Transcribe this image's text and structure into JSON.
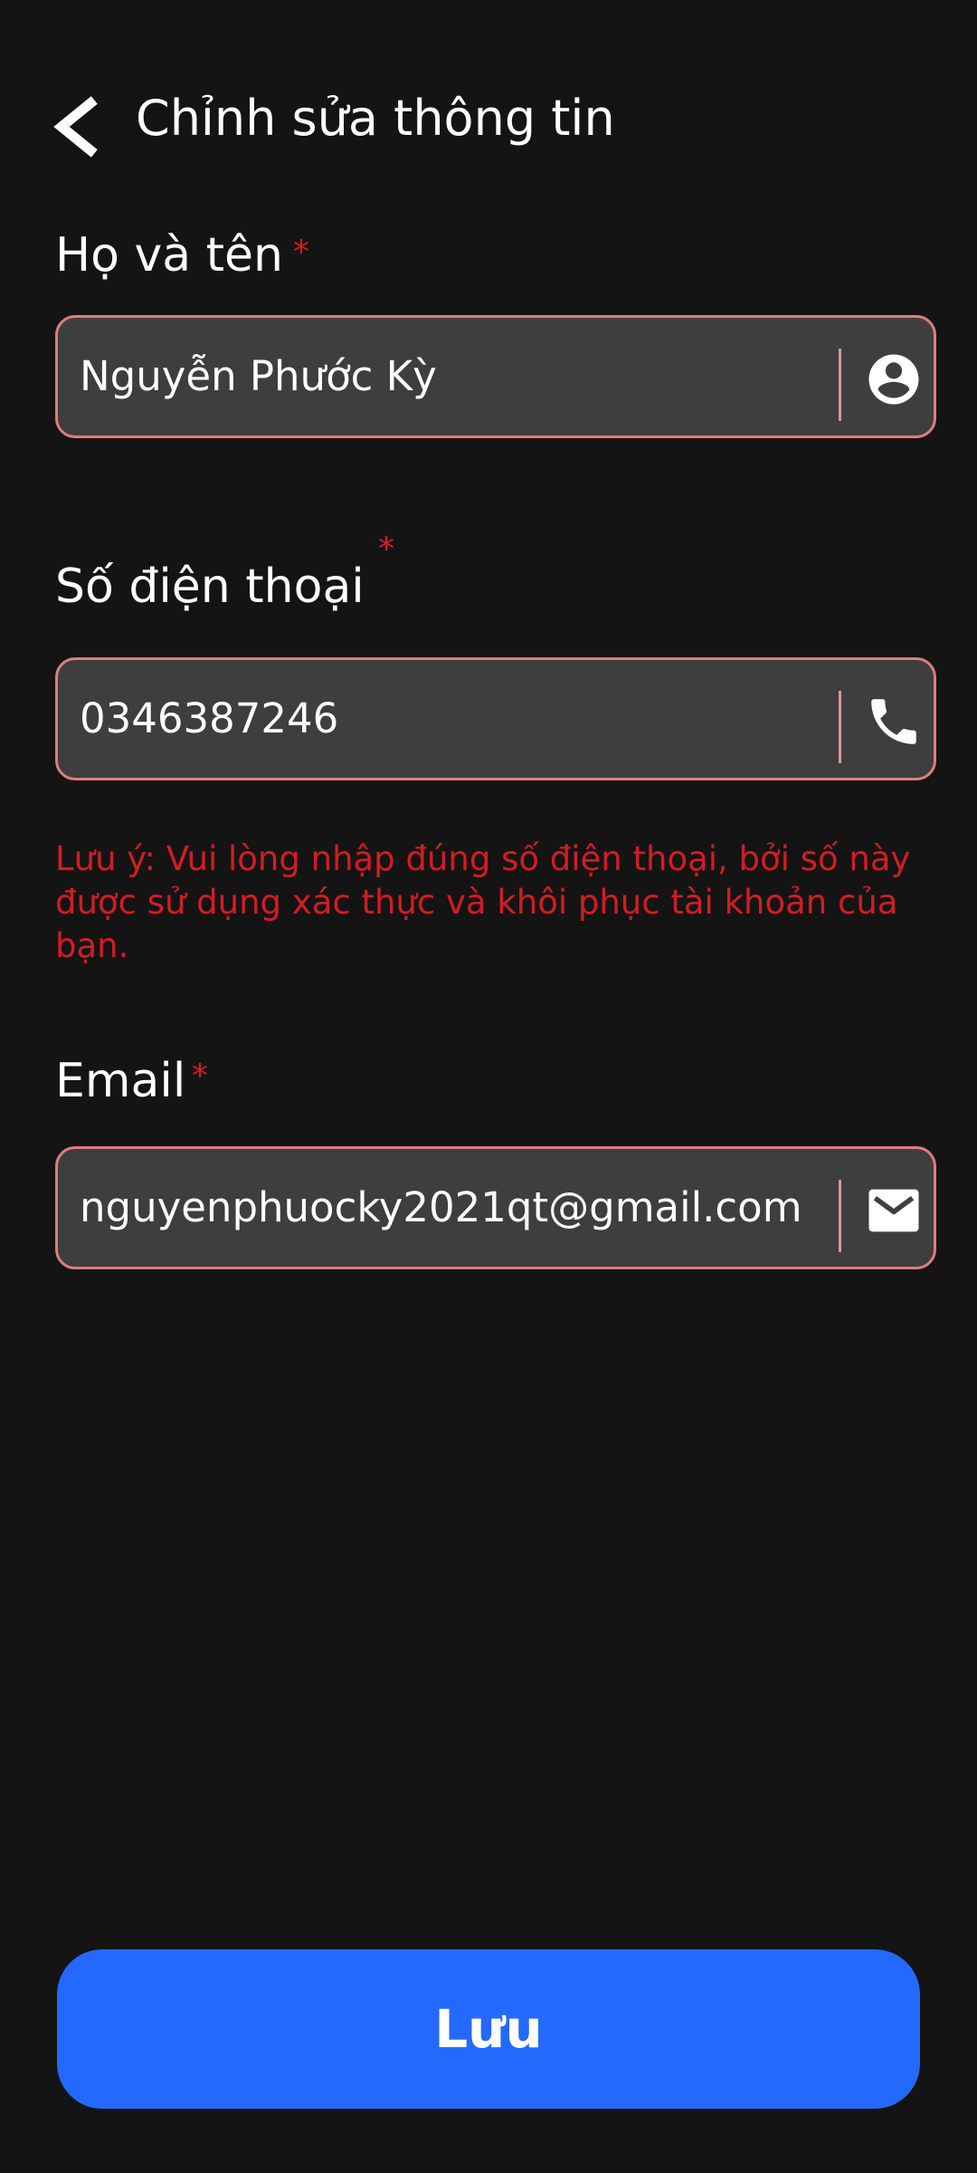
{
  "header": {
    "title": "Chỉnh sửa thông tin",
    "back_icon": "chevron-left-icon"
  },
  "form": {
    "full_name": {
      "label": "Họ và tên",
      "required_mark": "*",
      "value": "Nguyễn Phước Kỳ",
      "icon": "account-circle-icon"
    },
    "phone": {
      "label": "Số điện thoại",
      "required_mark": "*",
      "value": "0346387246",
      "icon": "phone-icon"
    },
    "phone_note": "Lưu ý: Vui lòng nhập đúng số điện thoại, bởi số này được sử dụng xác thực và khôi phục tài khoản của bạn.",
    "email": {
      "label": "Email",
      "required_mark": "*",
      "value": "nguyenphuocky2021qt@gmail.com",
      "icon": "mail-icon"
    }
  },
  "footer": {
    "save_label": "Lưu"
  },
  "colors": {
    "background": "#141414",
    "field_bg": "#3e3e3e",
    "field_border": "#e17c7c",
    "required": "#d31c24",
    "primary": "#2469fe"
  }
}
